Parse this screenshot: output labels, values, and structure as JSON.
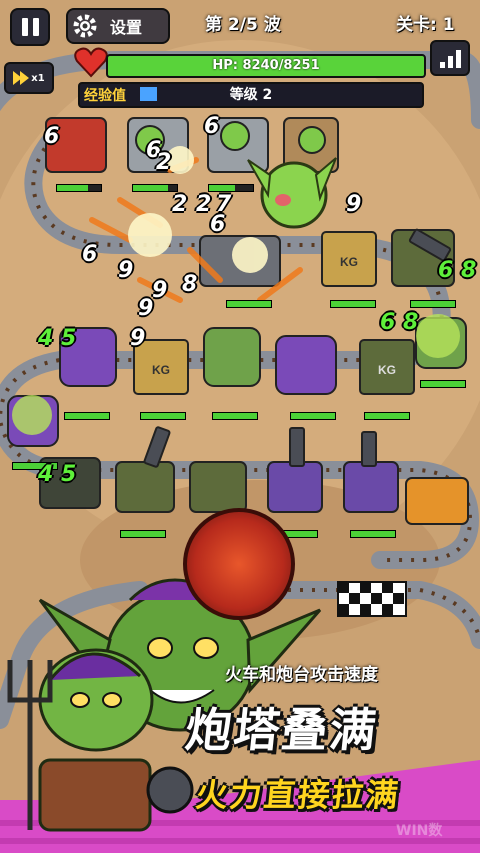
{
  "hud": {
    "settings_label": "设置",
    "wave_text": "第 2/5 波",
    "level_text": "关卡: 1",
    "speed_label": "x1",
    "hp_text": "HP: 8240/8251",
    "hp_fraction": 0.9987,
    "xp_label": "经验值",
    "xp_fraction": 0.05,
    "player_level_text": "等级 2"
  },
  "tower_labels": [
    "KG",
    "KG",
    "KG"
  ],
  "damage_numbers": [
    "6",
    "6",
    "2",
    "6",
    "2",
    "2",
    "7",
    "9",
    "6",
    "9",
    "6",
    "9",
    "8",
    "9",
    "9",
    "4 5",
    "6 8",
    "6 8",
    "4 5"
  ],
  "promo": {
    "description": "火车和炮台攻击速度",
    "headline": "炮塔叠满",
    "subheadline": "火力直接拉满"
  },
  "watermark": "WIN数",
  "colors": {
    "hp_green": "#59d33a",
    "xp_blue": "#4aa3ff",
    "accent_yellow": "#ffd51f",
    "promo_bg_pink": "#d94bc7",
    "ground": "#c9a173"
  }
}
